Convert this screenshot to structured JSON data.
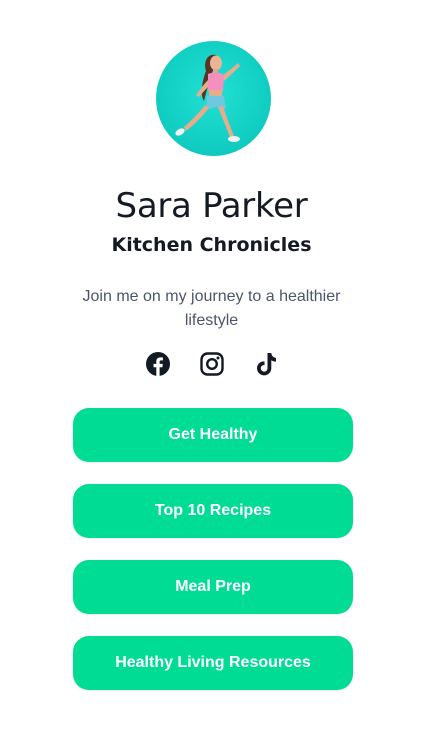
{
  "profile": {
    "name": "Sara Parker",
    "subtitle": "Kitchen Chronicles",
    "bio": "Join me on my journey to a healthier lifestyle",
    "avatar_icon": "avatar-photo-running-woman"
  },
  "socials": [
    {
      "name": "facebook",
      "icon": "facebook-icon"
    },
    {
      "name": "instagram",
      "icon": "instagram-icon"
    },
    {
      "name": "tiktok",
      "icon": "tiktok-icon"
    }
  ],
  "links": [
    {
      "label": "Get Healthy"
    },
    {
      "label": "Top 10 Recipes"
    },
    {
      "label": "Meal Prep"
    },
    {
      "label": "Healthy Living Resources"
    }
  ],
  "colors": {
    "accent": "#00dc94",
    "text_dark": "#141a24",
    "text_muted": "#4b566b",
    "avatar_bg": "#12cfc3",
    "background": "#ffffff"
  }
}
